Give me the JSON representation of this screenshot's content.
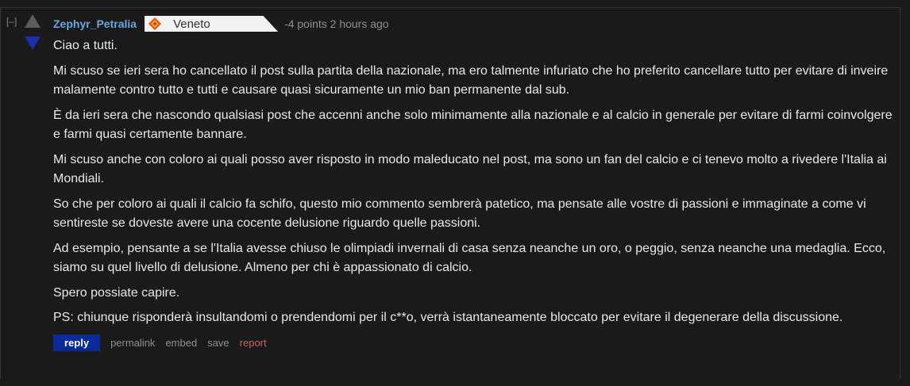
{
  "comment": {
    "collapse_label": "[–]",
    "author": "Zephyr_Petralia",
    "flair_text": "Veneto",
    "score_time": "-4 points 2 hours ago",
    "paragraphs": [
      "Ciao a tutti.",
      "Mi scuso se ieri sera ho cancellato il post sulla partita della nazionale, ma ero talmente infuriato che ho preferito cancellare tutto per evitare di inveire malamente contro tutto e tutti e causare quasi sicuramente un mio ban permanente dal sub.",
      "È da ieri sera che nascondo qualsiasi post che accenni anche solo minimamente alla nazionale e al calcio in generale per evitare di farmi coinvolgere e farmi quasi certamente bannare.",
      "Mi scuso anche con coloro ai quali posso aver risposto in modo maleducato nel post, ma sono un fan del calcio e ci tenevo molto a rivedere l'Italia ai Mondiali.",
      "So che per coloro ai quali il calcio fa schifo, questo mio commento sembrerà patetico, ma pensate alle vostre di passioni e immaginate a come vi sentireste se doveste avere una cocente delusione riguardo quelle passioni.",
      "Ad esempio, pensante a se l'Italia avesse chiuso le olimpiadi invernali di casa senza neanche un oro, o peggio, senza neanche una medaglia. Ecco, siamo su quel livello di delusione. Almeno per chi è appassionato di calcio.",
      "Spero possiate capire.",
      "PS: chiunque risponderà insultandomi o prendendomi per il c**o, verrà istantaneamente bloccato per evitare il degenerare della discussione."
    ],
    "buttons": {
      "reply": "reply",
      "permalink": "permalink",
      "embed": "embed",
      "save": "save",
      "report": "report"
    }
  },
  "colors": {
    "background": "#1a1a1b",
    "author": "#6ea4dc",
    "downvote_active": "#1a2eaa",
    "reply_button": "#0b2a9a",
    "report": "#c9625a"
  },
  "icons": {
    "upvote": "upvote-arrow-icon",
    "downvote": "downvote-arrow-icon",
    "flair": "veneto-flag-icon"
  }
}
